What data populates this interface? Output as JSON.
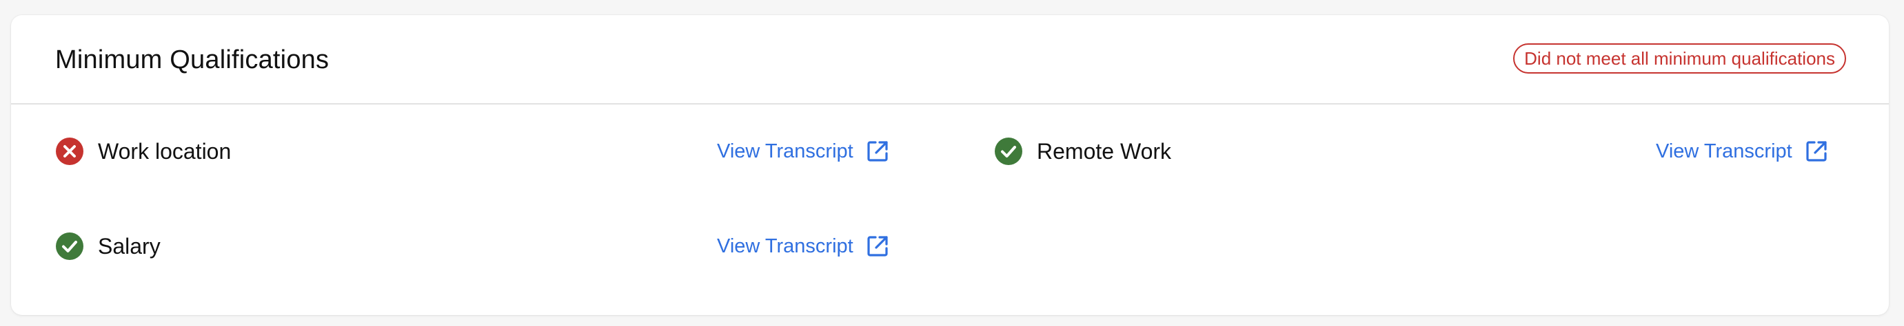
{
  "header": {
    "title": "Minimum Qualifications",
    "status_badge": "Did not meet all minimum qualifications"
  },
  "colors": {
    "fail": "#c6332f",
    "pass": "#3f7a3a",
    "link": "#2f6fe0"
  },
  "qualifications": [
    {
      "label": "Work location",
      "status": "fail",
      "icon": "x-circle-icon",
      "link_label": "View Transcript"
    },
    {
      "label": "Remote Work",
      "status": "pass",
      "icon": "check-circle-icon",
      "link_label": "View Transcript"
    },
    {
      "label": "Salary",
      "status": "pass",
      "icon": "check-circle-icon",
      "link_label": "View Transcript"
    }
  ]
}
